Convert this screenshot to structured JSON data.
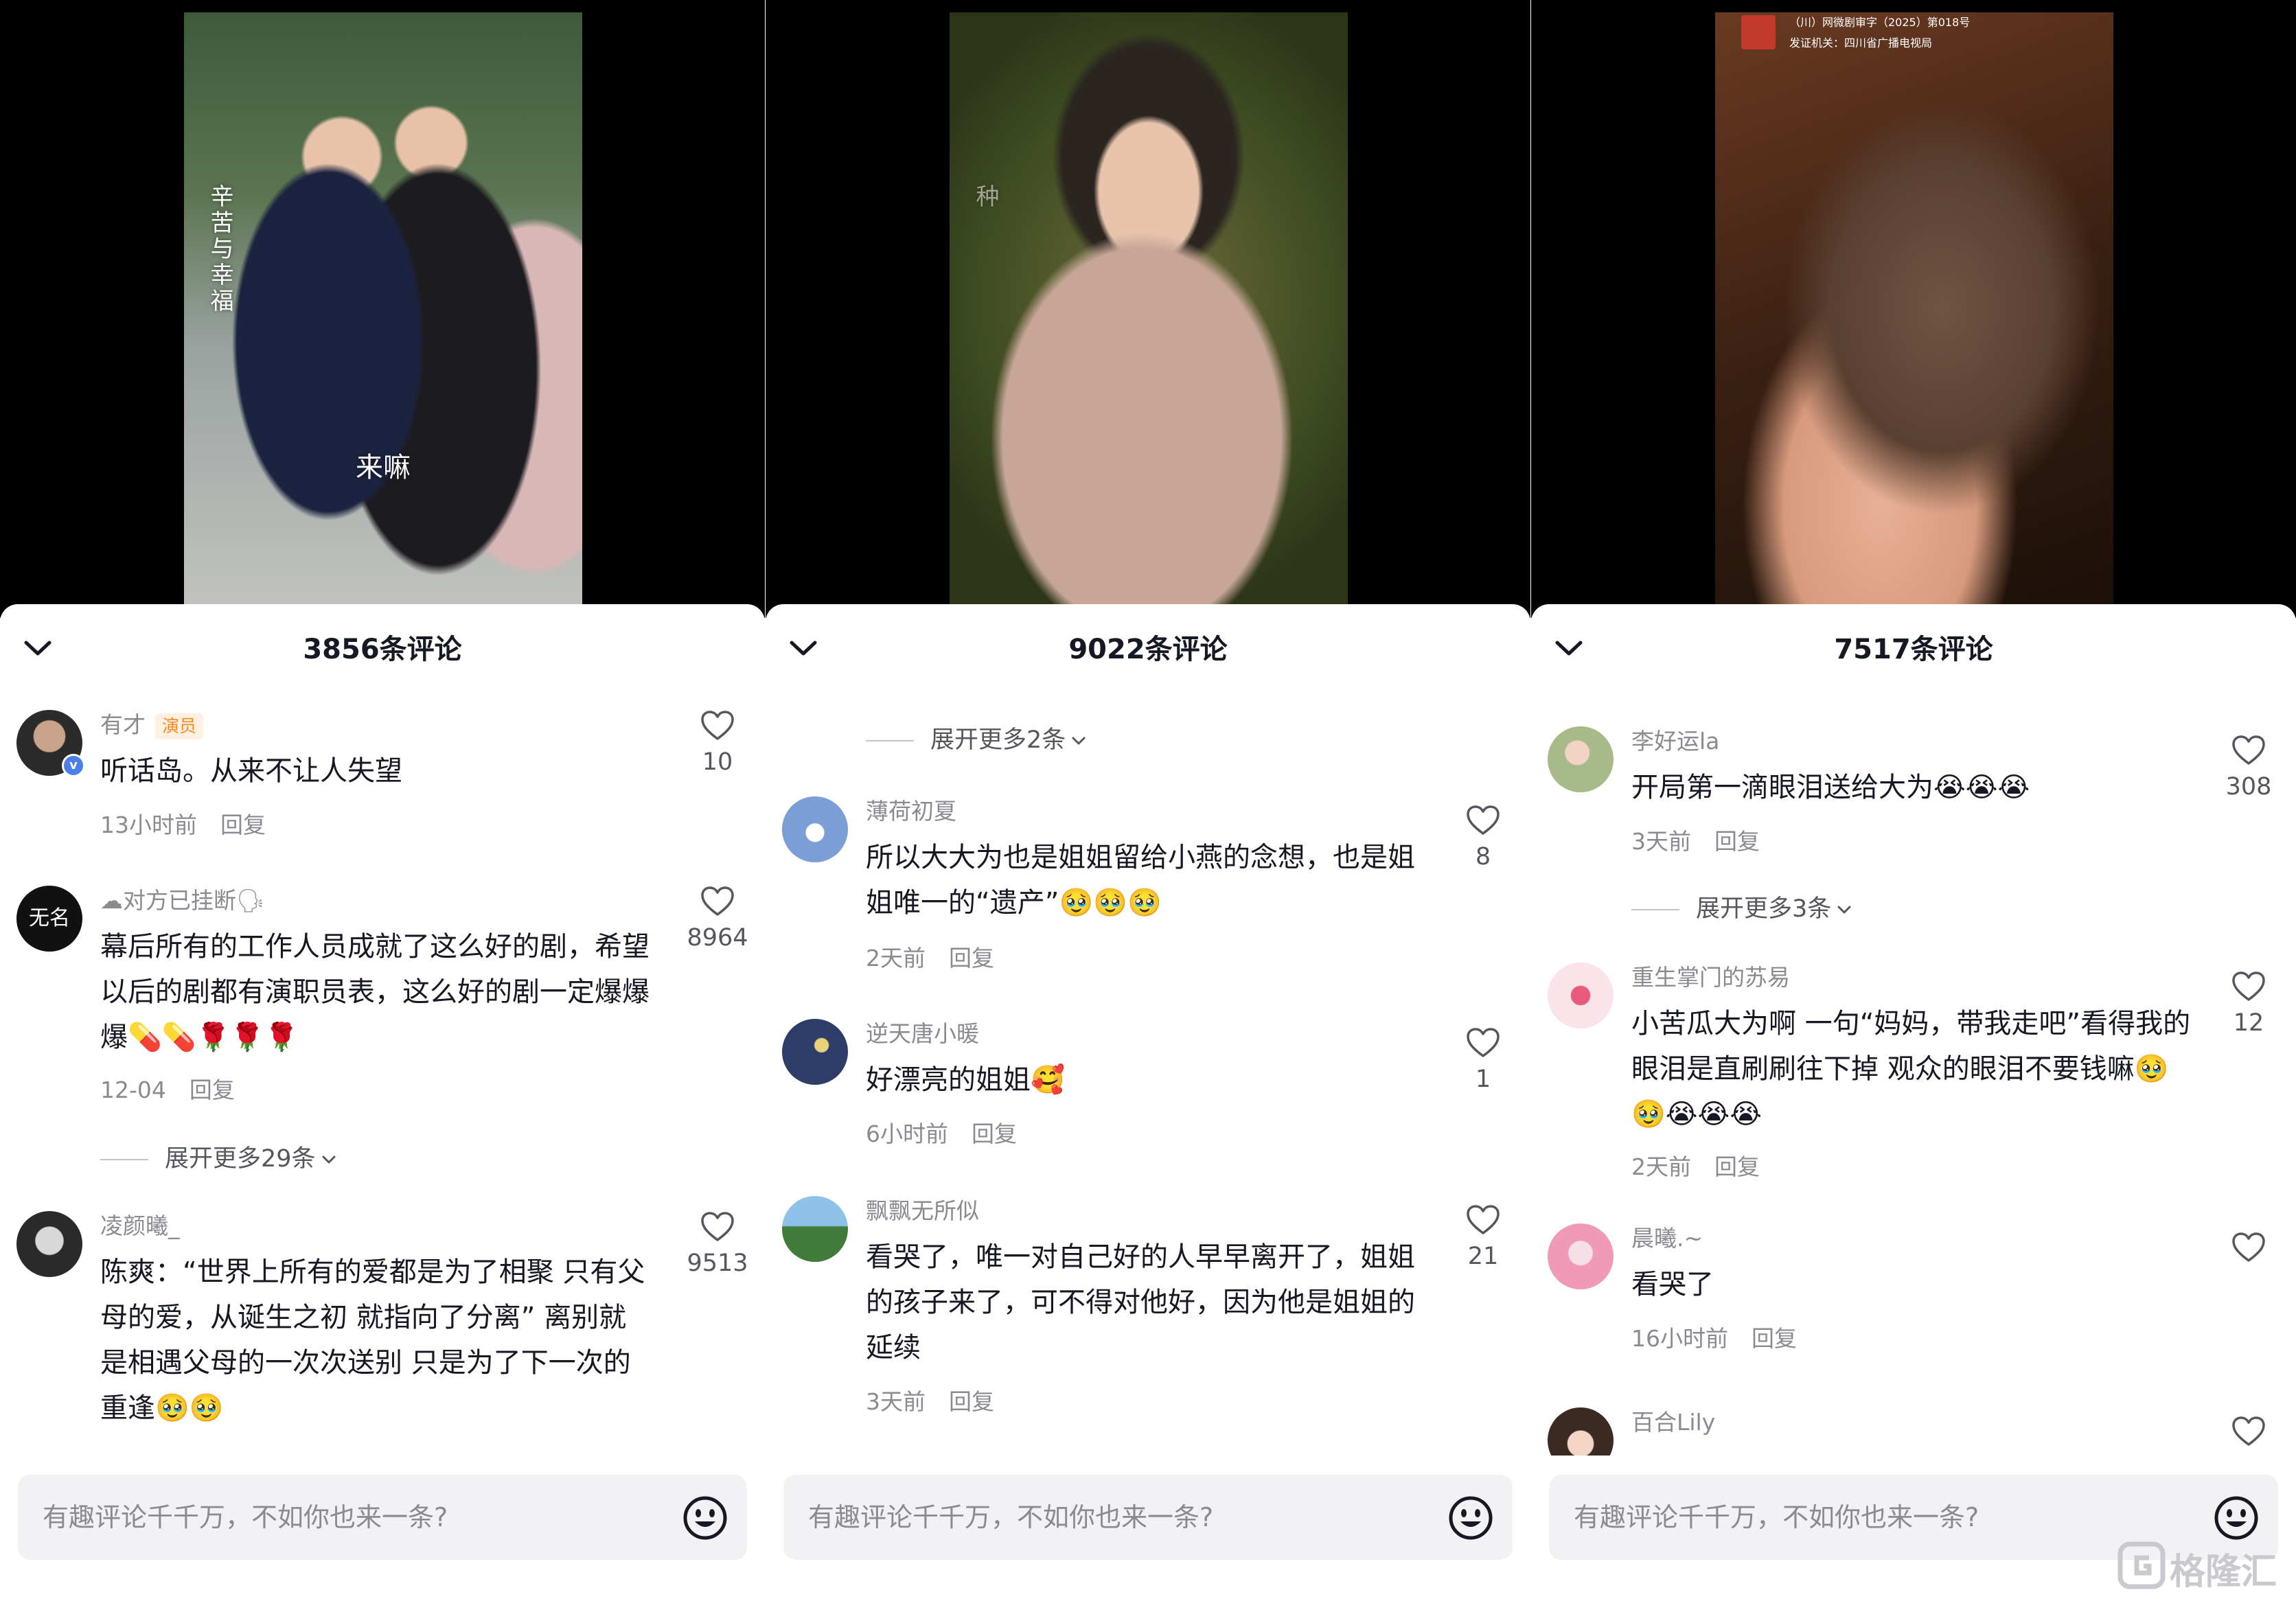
{
  "panels": [
    {
      "video": {
        "captions": [
          "辛苦与幸福",
          "来嘛"
        ]
      },
      "comment_count_title": "3856条评论",
      "comments": [
        {
          "username": "有才",
          "role_tag": "演员",
          "text": "听话岛。从来不让人失望",
          "time": "13小时前",
          "reply": "回复",
          "likes": "10"
        },
        {
          "username": "☁对方已挂断🗣",
          "text": "幕后所有的工作人员成就了这么好的剧，希望以后的剧都有演职员表，这么好的剧一定爆爆爆💊💊🌹🌹🌹",
          "time": "12-04",
          "reply": "回复",
          "likes": "8964",
          "avatar_text": "无名"
        },
        {
          "username": "凌颜曦_",
          "text": "陈爽：“世界上所有的爱都是为了相聚 只有父母的爱，从诞生之初 就指向了分离” 离别就是相遇父母的一次次送别 只是为了下一次的重逢🥹🥹",
          "likes": "9513"
        }
      ],
      "expand_more": "展开更多29条",
      "input_placeholder": "有趣评论千千万，不如你也来一条?"
    },
    {
      "video": {
        "captions": [
          "种"
        ]
      },
      "comment_count_title": "9022条评论",
      "expand_more": "展开更多2条",
      "comments": [
        {
          "username": "薄荷初夏",
          "text": "所以大大为也是姐姐留给小燕的念想，也是姐姐唯一的“遗产”🥹🥹🥹",
          "time": "2天前",
          "reply": "回复",
          "likes": "8"
        },
        {
          "username": "逆天唐小暖",
          "text": "好漂亮的姐姐🥰",
          "time": "6小时前",
          "reply": "回复",
          "likes": "1"
        },
        {
          "username": "飘飘无所似",
          "text": "看哭了，唯一对自己好的人早早离开了，姐姐的孩子来了，可不得对他好，因为他是姐姐的延续",
          "time": "3天前",
          "reply": "回复",
          "likes": "21"
        }
      ],
      "input_placeholder": "有趣评论千千万，不如你也来一条?"
    },
    {
      "video": {
        "license_lines": [
          "（川）网微剧审字（2025）第018号",
          "发证机关：四川省广播电视局"
        ]
      },
      "comment_count_title": "7517条评论",
      "comments": [
        {
          "username": "李好运la",
          "text": "开局第一滴眼泪送给大为😭😭😭",
          "time": "3天前",
          "reply": "回复",
          "likes": "308"
        },
        {
          "username": "重生掌门的苏易",
          "text": "小苦瓜大为啊 一句“妈妈，带我走吧”看得我的眼泪是直刷刷往下掉 观众的眼泪不要钱嘛🥹🥹😭😭😭",
          "time": "2天前",
          "reply": "回复",
          "likes": "12"
        },
        {
          "username": "晨曦.~",
          "text": "看哭了",
          "time": "16小时前",
          "reply": "回复",
          "likes": ""
        },
        {
          "username": "百合Lily",
          "likes": ""
        }
      ],
      "expand_more": "展开更多3条",
      "input_placeholder": "有趣评论千千万，不如你也来一条?"
    }
  ],
  "watermark": "格隆汇",
  "colors": {
    "accent_tag_bg": "#fff0e2",
    "accent_tag_fg": "#f58a1f",
    "secondary_text": "#8a8b91",
    "verify_blue": "#4b7ee8"
  },
  "icons": [
    "chevron-down-icon",
    "heart-icon",
    "smile-icon",
    "verify-icon",
    "watermark-logo-icon"
  ]
}
